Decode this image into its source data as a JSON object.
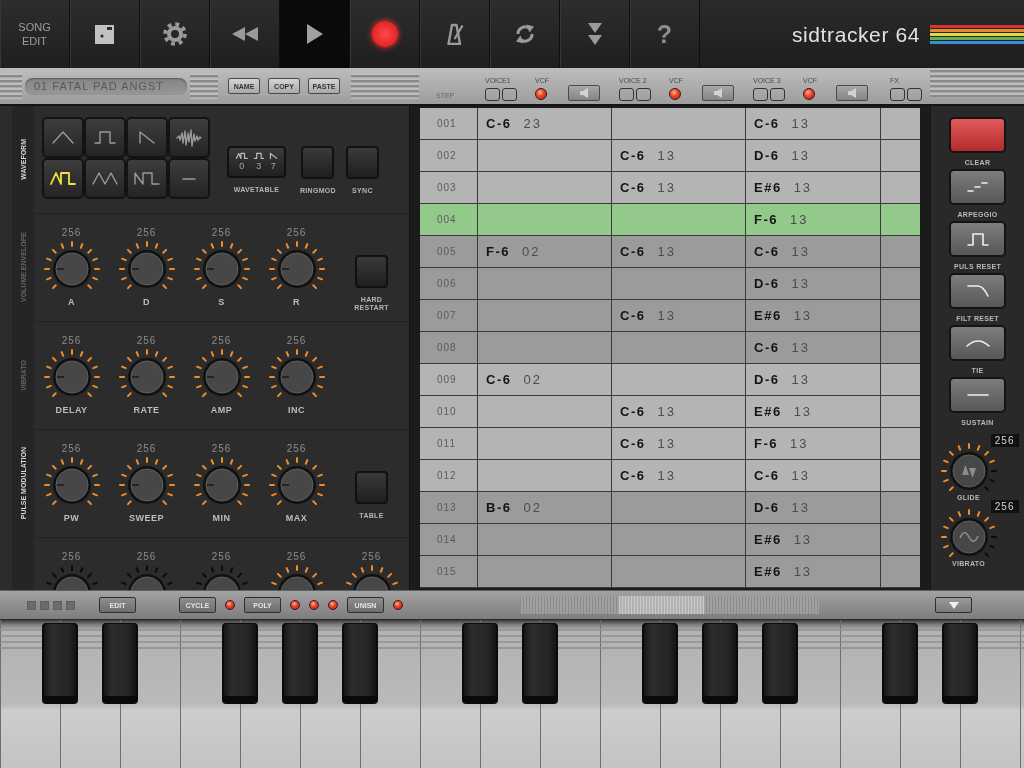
{
  "toolbar": {
    "buttons": [
      {
        "kind": "text",
        "label": "SONG EDIT",
        "selected": false
      },
      {
        "kind": "disk",
        "selected": false
      },
      {
        "kind": "gear",
        "selected": false
      },
      {
        "kind": "rewind",
        "selected": false
      },
      {
        "kind": "play",
        "selected": true
      },
      {
        "kind": "record",
        "selected": false
      },
      {
        "kind": "metronome",
        "selected": false
      },
      {
        "kind": "loop",
        "selected": false
      },
      {
        "kind": "skip-down",
        "selected": false
      },
      {
        "kind": "help",
        "label": "?",
        "selected": false
      }
    ],
    "logo": "sidtracker 64"
  },
  "instrument": {
    "name": "01 FATAL PAD ANGST",
    "buttons": [
      "NAME",
      "COPY",
      "PASTE"
    ]
  },
  "track_header": {
    "step_label": "STEP",
    "voices": [
      {
        "label": "VOICE1",
        "filter_label": "VCF",
        "filter_on": true
      },
      {
        "label": "VOICE 2",
        "filter_label": "VCF",
        "filter_on": true
      },
      {
        "label": "VOICE 3",
        "filter_label": "VCF",
        "filter_on": true
      }
    ],
    "fx_label": "FX"
  },
  "waveform": {
    "label": "WAVEFORM",
    "enabled": true,
    "shapes": [
      {
        "kind": "triangle",
        "selected": false
      },
      {
        "kind": "pulse",
        "selected": false
      },
      {
        "kind": "saw",
        "selected": false
      },
      {
        "kind": "noise",
        "selected": false
      },
      {
        "kind": "tri-pulse",
        "selected": true
      },
      {
        "kind": "double-tri",
        "selected": false
      },
      {
        "kind": "saw-pulse",
        "selected": false
      },
      {
        "kind": "flat",
        "selected": false
      }
    ],
    "wavetable": {
      "label": "WAVETABLE",
      "steps": [
        {
          "kind": "tri-pulse",
          "value": "0"
        },
        {
          "kind": "pulse",
          "value": "3"
        },
        {
          "kind": "saw",
          "value": "7"
        }
      ]
    },
    "toggles": [
      {
        "label": "RINGMOD",
        "on": false
      },
      {
        "label": "SYNC",
        "on": false
      }
    ]
  },
  "knob_sections": [
    {
      "label": "VOLUME ENVELOPE",
      "enabled": false,
      "knobs": [
        {
          "value": "256",
          "label": "A",
          "lit": true
        },
        {
          "value": "256",
          "label": "D",
          "lit": true
        },
        {
          "value": "256",
          "label": "S",
          "lit": true
        },
        {
          "value": "256",
          "label": "R",
          "lit": true
        }
      ],
      "toggle": {
        "label": "HARD RESTART",
        "on": false
      }
    },
    {
      "label": "VIBRATO",
      "enabled": false,
      "knobs": [
        {
          "value": "256",
          "label": "DELAY",
          "lit": true
        },
        {
          "value": "256",
          "label": "RATE",
          "lit": true
        },
        {
          "value": "256",
          "label": "AMP",
          "lit": true
        },
        {
          "value": "256",
          "label": "INC",
          "lit": true
        }
      ]
    },
    {
      "label": "PULSE MODULATION",
      "enabled": true,
      "knobs": [
        {
          "value": "256",
          "label": "PW",
          "lit": true
        },
        {
          "value": "256",
          "label": "SWEEP",
          "lit": true
        },
        {
          "value": "256",
          "label": "MIN",
          "lit": true
        },
        {
          "value": "256",
          "label": "MAX",
          "lit": true
        }
      ],
      "toggle": {
        "label": "TABLE",
        "on": false
      }
    },
    {
      "knobs": [
        {
          "value": "256",
          "lit": false
        },
        {
          "value": "256",
          "lit": false
        },
        {
          "value": "256",
          "lit": false
        },
        {
          "value": "256",
          "lit": true
        },
        {
          "value": "256",
          "lit": true
        }
      ]
    }
  ],
  "pattern": {
    "rows": [
      {
        "step": "001",
        "selected": false,
        "cells": [
          {
            "note": "C-6",
            "value": "23"
          },
          null,
          {
            "note": "C-6",
            "value": "13"
          }
        ]
      },
      {
        "step": "002",
        "selected": false,
        "cells": [
          null,
          {
            "note": "C-6",
            "value": "13"
          },
          {
            "note": "D-6",
            "value": "13"
          }
        ]
      },
      {
        "step": "003",
        "selected": false,
        "cells": [
          null,
          {
            "note": "C-6",
            "value": "13"
          },
          {
            "note": "E#6",
            "value": "13"
          }
        ]
      },
      {
        "step": "004",
        "selected": true,
        "cells": [
          null,
          null,
          {
            "note": "F-6",
            "value": "13"
          }
        ]
      },
      {
        "step": "005",
        "selected": false,
        "cells": [
          {
            "note": "F-6",
            "value": "02"
          },
          {
            "note": "C-6",
            "value": "13"
          },
          {
            "note": "C-6",
            "value": "13"
          }
        ]
      },
      {
        "step": "006",
        "selected": false,
        "cells": [
          null,
          null,
          {
            "note": "D-6",
            "value": "13"
          }
        ]
      },
      {
        "step": "007",
        "selected": false,
        "cells": [
          null,
          {
            "note": "C-6",
            "value": "13"
          },
          {
            "note": "E#6",
            "value": "13"
          }
        ]
      },
      {
        "step": "008",
        "selected": false,
        "cells": [
          null,
          null,
          {
            "note": "C-6",
            "value": "13"
          }
        ]
      },
      {
        "step": "009",
        "selected": false,
        "cells": [
          {
            "note": "C-6",
            "value": "02"
          },
          null,
          {
            "note": "D-6",
            "value": "13"
          }
        ]
      },
      {
        "step": "010",
        "selected": false,
        "cells": [
          null,
          {
            "note": "C-6",
            "value": "13"
          },
          {
            "note": "E#6",
            "value": "13"
          }
        ]
      },
      {
        "step": "011",
        "selected": false,
        "cells": [
          null,
          {
            "note": "C-6",
            "value": "13"
          },
          {
            "note": "F-6",
            "value": "13"
          }
        ]
      },
      {
        "step": "012",
        "selected": false,
        "cells": [
          null,
          {
            "note": "C-6",
            "value": "13"
          },
          {
            "note": "C-6",
            "value": "13"
          }
        ]
      },
      {
        "step": "013",
        "selected": false,
        "cells": [
          {
            "note": "B-6",
            "value": "02"
          },
          null,
          {
            "note": "D-6",
            "value": "13"
          }
        ]
      },
      {
        "step": "014",
        "selected": false,
        "cells": [
          null,
          null,
          {
            "note": "E#6",
            "value": "13"
          }
        ]
      },
      {
        "step": "015",
        "selected": false,
        "cells": [
          null,
          null,
          {
            "note": "E#6",
            "value": "13"
          }
        ]
      }
    ]
  },
  "commands": [
    {
      "kind": "clear",
      "label": "CLEAR"
    },
    {
      "kind": "arpeggio",
      "label": "ARPEGGIO"
    },
    {
      "kind": "pulse",
      "label": "PULS RESET"
    },
    {
      "kind": "filter",
      "label": "FILT RESET"
    },
    {
      "kind": "tie",
      "label": "TIE"
    },
    {
      "kind": "sustain",
      "label": "SUSTAIN"
    }
  ],
  "side_knobs": [
    {
      "kind": "glide",
      "value": "256",
      "label": "GLIDE",
      "lit": true
    },
    {
      "kind": "vibrato",
      "value": "256",
      "label": "VIBRATO",
      "lit": true
    }
  ],
  "keyboard_bar": {
    "controls": [
      {
        "kind": "button",
        "label": "EDIT"
      },
      {
        "kind": "button",
        "label": "CYCLE"
      },
      {
        "kind": "led",
        "on": true
      },
      {
        "kind": "button",
        "label": "POLY"
      },
      {
        "kind": "led",
        "on": true
      },
      {
        "kind": "led",
        "on": true
      },
      {
        "kind": "led",
        "on": true
      },
      {
        "kind": "button",
        "label": "UNISN"
      },
      {
        "kind": "led",
        "on": true
      }
    ]
  }
}
